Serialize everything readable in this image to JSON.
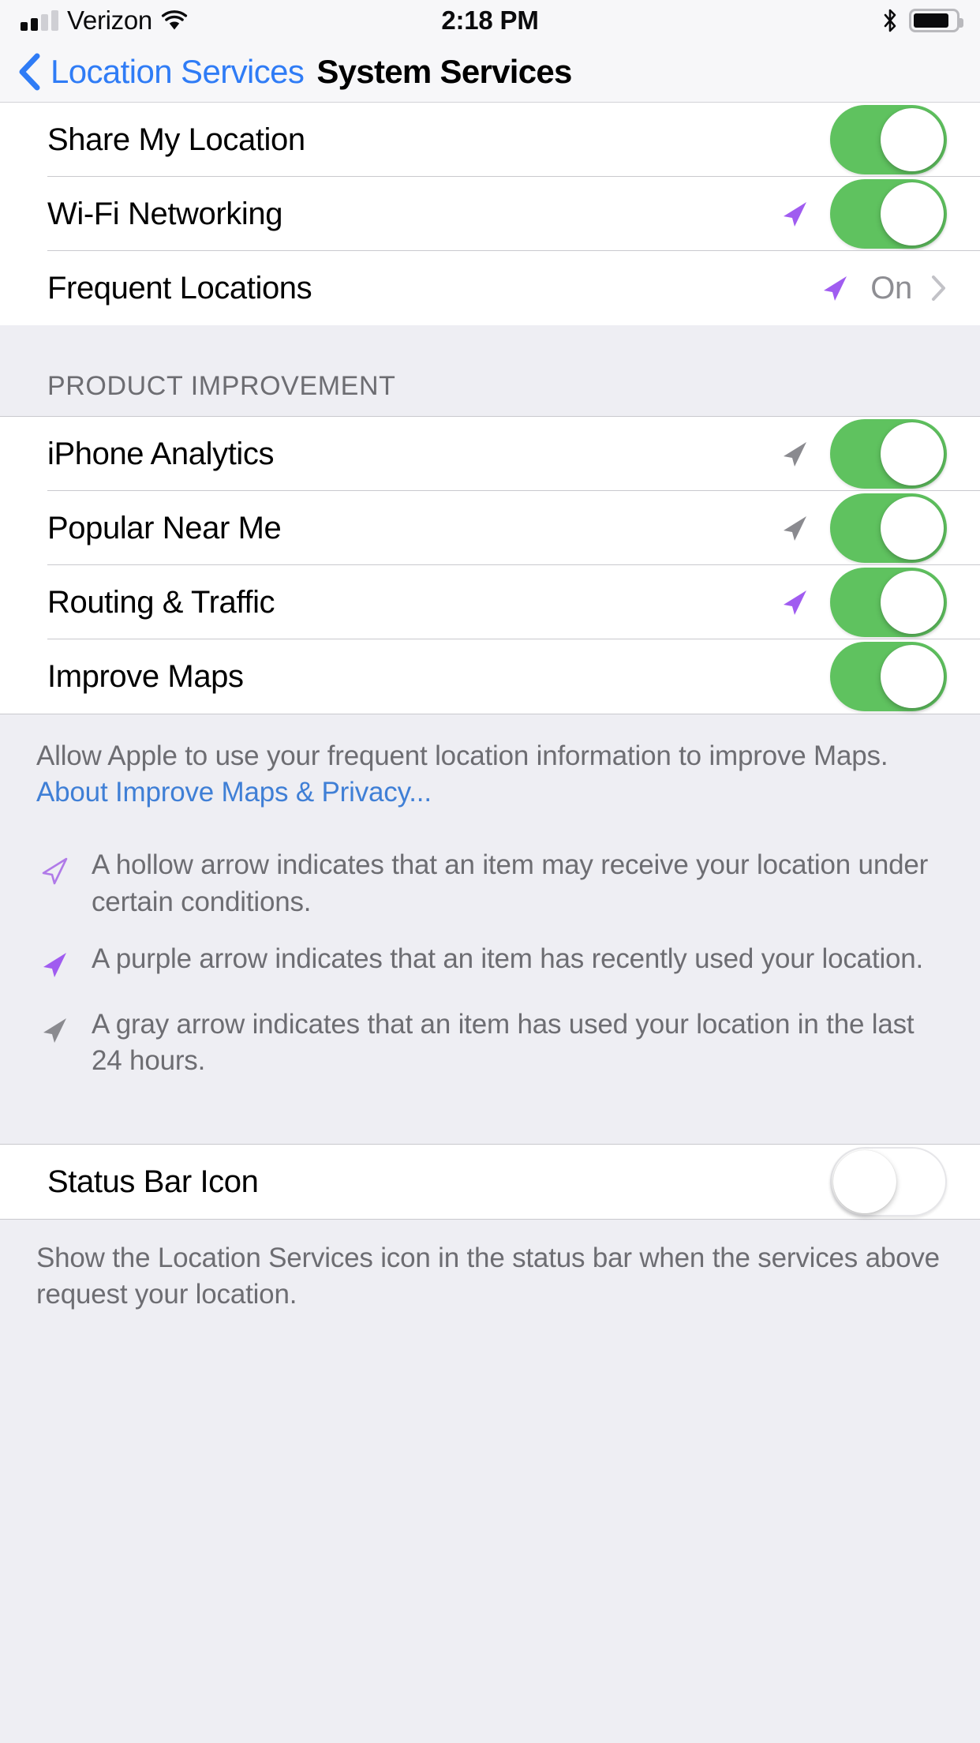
{
  "status_bar": {
    "carrier": "Verizon",
    "time": "2:18 PM",
    "signal_bars_filled": 2,
    "signal_bars_total": 4,
    "wifi_icon": "wifi-icon",
    "bluetooth_icon": "bluetooth-icon",
    "battery_icon": "battery-icon",
    "battery_percent": 85
  },
  "nav": {
    "back_icon": "chevron-left-icon",
    "back_label": "Location Services",
    "title": "System Services"
  },
  "colors": {
    "switch_on": "#5fc25f",
    "accent_blue": "#2f7cf6",
    "link_blue": "#3f7fd6",
    "arrow_purple": "#a05cf0",
    "arrow_gray": "#8a8a8f",
    "group_bg": "#eeeef3",
    "row_bg": "#ffffff",
    "separator": "#c9c9ce",
    "secondary_text": "#6d6d72"
  },
  "sections": [
    {
      "name": "top-services",
      "header": null,
      "rows": [
        {
          "label": "Share My Location",
          "control": "switch",
          "switch_state": "on",
          "arrow": "none"
        },
        {
          "label": "Wi-Fi Networking",
          "control": "switch",
          "switch_state": "on",
          "arrow": "purple"
        },
        {
          "label": "Frequent Locations",
          "control": "disclosure",
          "value": "On",
          "arrow": "purple",
          "chevron_icon": "chevron-right-icon"
        }
      ]
    },
    {
      "name": "product-improvement",
      "header": "PRODUCT IMPROVEMENT",
      "rows": [
        {
          "label": "iPhone Analytics",
          "control": "switch",
          "switch_state": "on",
          "arrow": "gray"
        },
        {
          "label": "Popular Near Me",
          "control": "switch",
          "switch_state": "on",
          "arrow": "gray"
        },
        {
          "label": "Routing & Traffic",
          "control": "switch",
          "switch_state": "on",
          "arrow": "purple"
        },
        {
          "label": "Improve Maps",
          "control": "switch",
          "switch_state": "on",
          "arrow": "none"
        }
      ],
      "footer": {
        "text": "Allow Apple to use your frequent location information to improve Maps. ",
        "link": "About Improve Maps & Privacy..."
      }
    },
    {
      "name": "status-bar-icon",
      "header": null,
      "rows": [
        {
          "label": "Status Bar Icon",
          "control": "switch",
          "switch_state": "off",
          "arrow": "none"
        }
      ],
      "footer": {
        "text": "Show the Location Services icon in the status bar when the services above request your location.",
        "link": null
      }
    }
  ],
  "legend": [
    {
      "arrow": "hollow",
      "arrow_icon": "location-arrow-hollow-icon",
      "text": "A hollow arrow indicates that an item may receive your location under certain conditions."
    },
    {
      "arrow": "purple",
      "arrow_icon": "location-arrow-purple-icon",
      "text": "A purple arrow indicates that an item has recently used your location."
    },
    {
      "arrow": "gray",
      "arrow_icon": "location-arrow-gray-icon",
      "text": "A gray arrow indicates that an item has used your location in the last 24 hours."
    }
  ]
}
